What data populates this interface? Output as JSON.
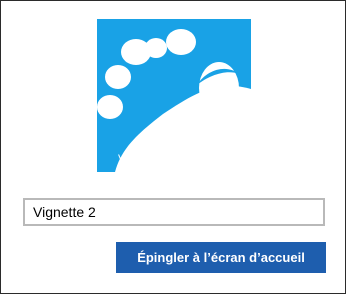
{
  "tile": {
    "icon": "foot-icon",
    "label": "Vignette 2",
    "background_color": "#19a2e6",
    "icon_color": "#ffffff"
  },
  "name_field": {
    "value": "Vignette 2"
  },
  "pin_button": {
    "label": "Épingler à l’écran d’accueil",
    "color": "#1e5eae"
  }
}
